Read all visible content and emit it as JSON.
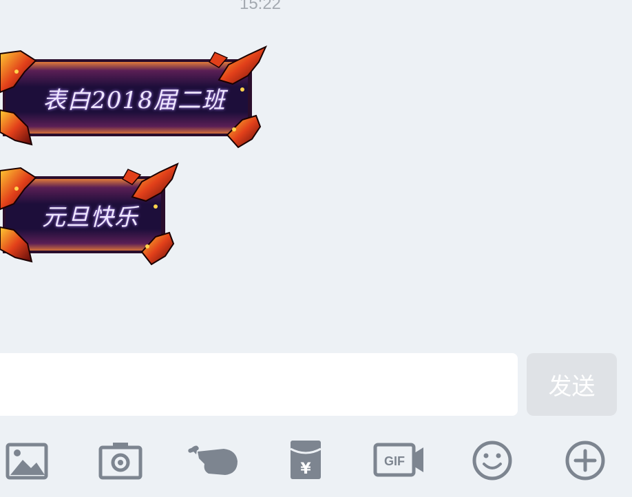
{
  "chat": {
    "timestamp": "15:22",
    "messages": [
      {
        "text": "表白2018届二班"
      },
      {
        "text": "元旦快乐"
      }
    ]
  },
  "composer": {
    "input_value": "",
    "send_label": "发送"
  },
  "toolbar": {
    "icons": [
      "image-icon",
      "camera-icon",
      "poke-icon",
      "red-packet-icon",
      "gif-icon",
      "emoji-icon",
      "add-icon"
    ],
    "icon_color": "#7d8590",
    "red_packet_symbol": "¥",
    "gif_label": "GIF"
  },
  "colors": {
    "background": "#edf1f5",
    "bubble_fill": "#1d0e3a",
    "send_button": "#dfe2e6"
  }
}
